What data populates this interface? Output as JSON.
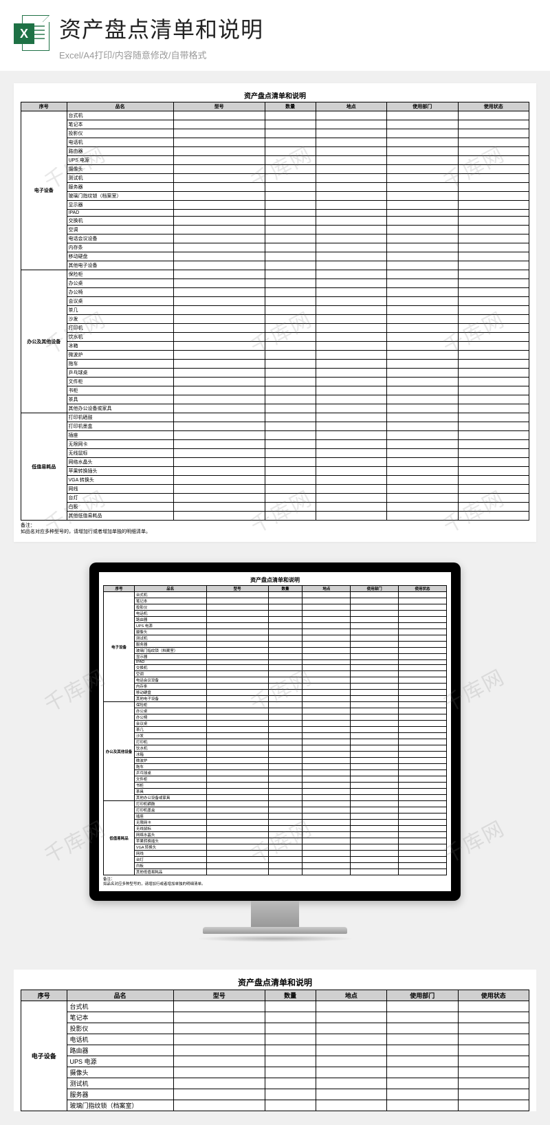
{
  "header": {
    "title": "资产盘点清单和说明",
    "subtitle": "Excel/A4打印/内容随意修改/自带格式",
    "icon_letter": "X"
  },
  "sheet": {
    "title": "资产盘点清单和说明",
    "columns": [
      "序号",
      "品名",
      "型号",
      "数量",
      "地点",
      "使用部门",
      "使用状态"
    ],
    "groups": [
      {
        "category": "电子设备",
        "items": [
          "台式机",
          "笔记本",
          "投影仪",
          "电话机",
          "路由器",
          "UPS 电源",
          "摄像头",
          "测试机",
          "服务器",
          "玻璃门指纹锁（档案室）",
          "显示器",
          "IPAD",
          "交换机",
          "空调",
          "电话会议设备",
          "内存条",
          "移动硬盘",
          "其他电子设备"
        ]
      },
      {
        "category": "办公及其他设备",
        "items": [
          "保险柜",
          "办公桌",
          "办公椅",
          "会议桌",
          "茶几",
          "沙发",
          "打印机",
          "饮水机",
          "冰箱",
          "微波炉",
          "拖车",
          "乒乓球桌",
          "文件柜",
          "书柜",
          "茶具",
          "其他办公设备或家具"
        ]
      },
      {
        "category": "低值易耗品",
        "items": [
          "打印机硒鼓",
          "打印机墨盒",
          "插座",
          "无限网卡",
          "无线鼠标",
          "网络水晶头",
          "苹果转换插头",
          "VGA 转换头",
          "网线",
          "台灯",
          "白板",
          "其他低值易耗品"
        ]
      }
    ],
    "remark_label": "备注：",
    "remark_text": "如品名对应多种型号的，请增加行或者增加单独的明细清单。"
  },
  "watermark": "千库网",
  "col_widths": [
    "9%",
    "21%",
    "18%",
    "10%",
    "14%",
    "14%",
    "14%"
  ]
}
